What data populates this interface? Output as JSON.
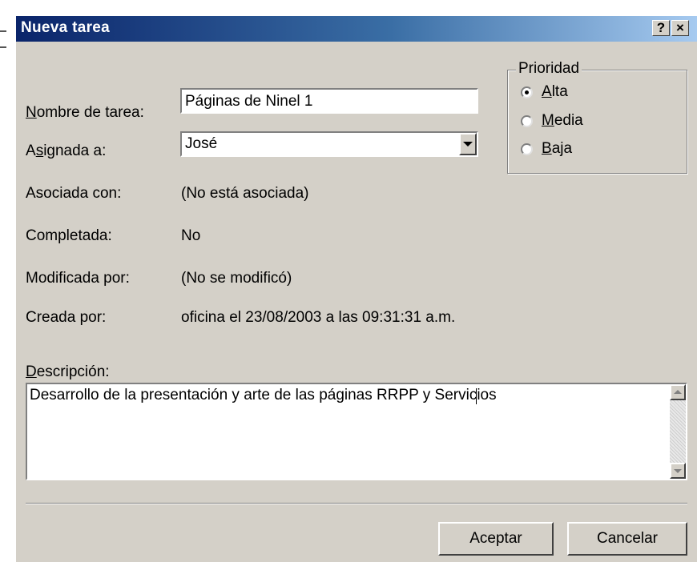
{
  "window": {
    "title": "Nueva tarea",
    "help_label": "?",
    "close_label": "×"
  },
  "form": {
    "name_label": "Nombre de tarea:",
    "name_accel": "N",
    "name_rest": "ombre de tarea:",
    "name_value": "Páginas de Ninel 1",
    "assigned_pre": "A",
    "assigned_accel": "s",
    "assigned_rest": "ignada a:",
    "assigned_value": "José",
    "associated_label": "Asociada con:",
    "associated_value": "(No está asociada)",
    "completed_label": "Completada:",
    "completed_value": "No",
    "modified_label": "Modificada por:",
    "modified_value": "(No se modificó)",
    "created_label": "Creada por:",
    "created_value": "oficina el 23/08/2003 a las 09:31:31 a.m.",
    "description_accel": "D",
    "description_rest": "escripción:",
    "description_value": "Desarrollo de la presentación y arte de las páginas RRPP y Servicios"
  },
  "priority": {
    "title": "Prioridad",
    "selected": "Alta",
    "options": [
      {
        "accel": "A",
        "rest": "lta"
      },
      {
        "accel": "M",
        "rest": "edia"
      },
      {
        "accel": "B",
        "rest": "aja"
      }
    ]
  },
  "buttons": {
    "ok_label": "Aceptar",
    "cancel_label": "Cancelar"
  },
  "icons": {
    "dropdown": "chevron-down-icon",
    "scroll_up": "scroll-up-arrow-icon",
    "scroll_down": "scroll-down-arrow-icon"
  }
}
